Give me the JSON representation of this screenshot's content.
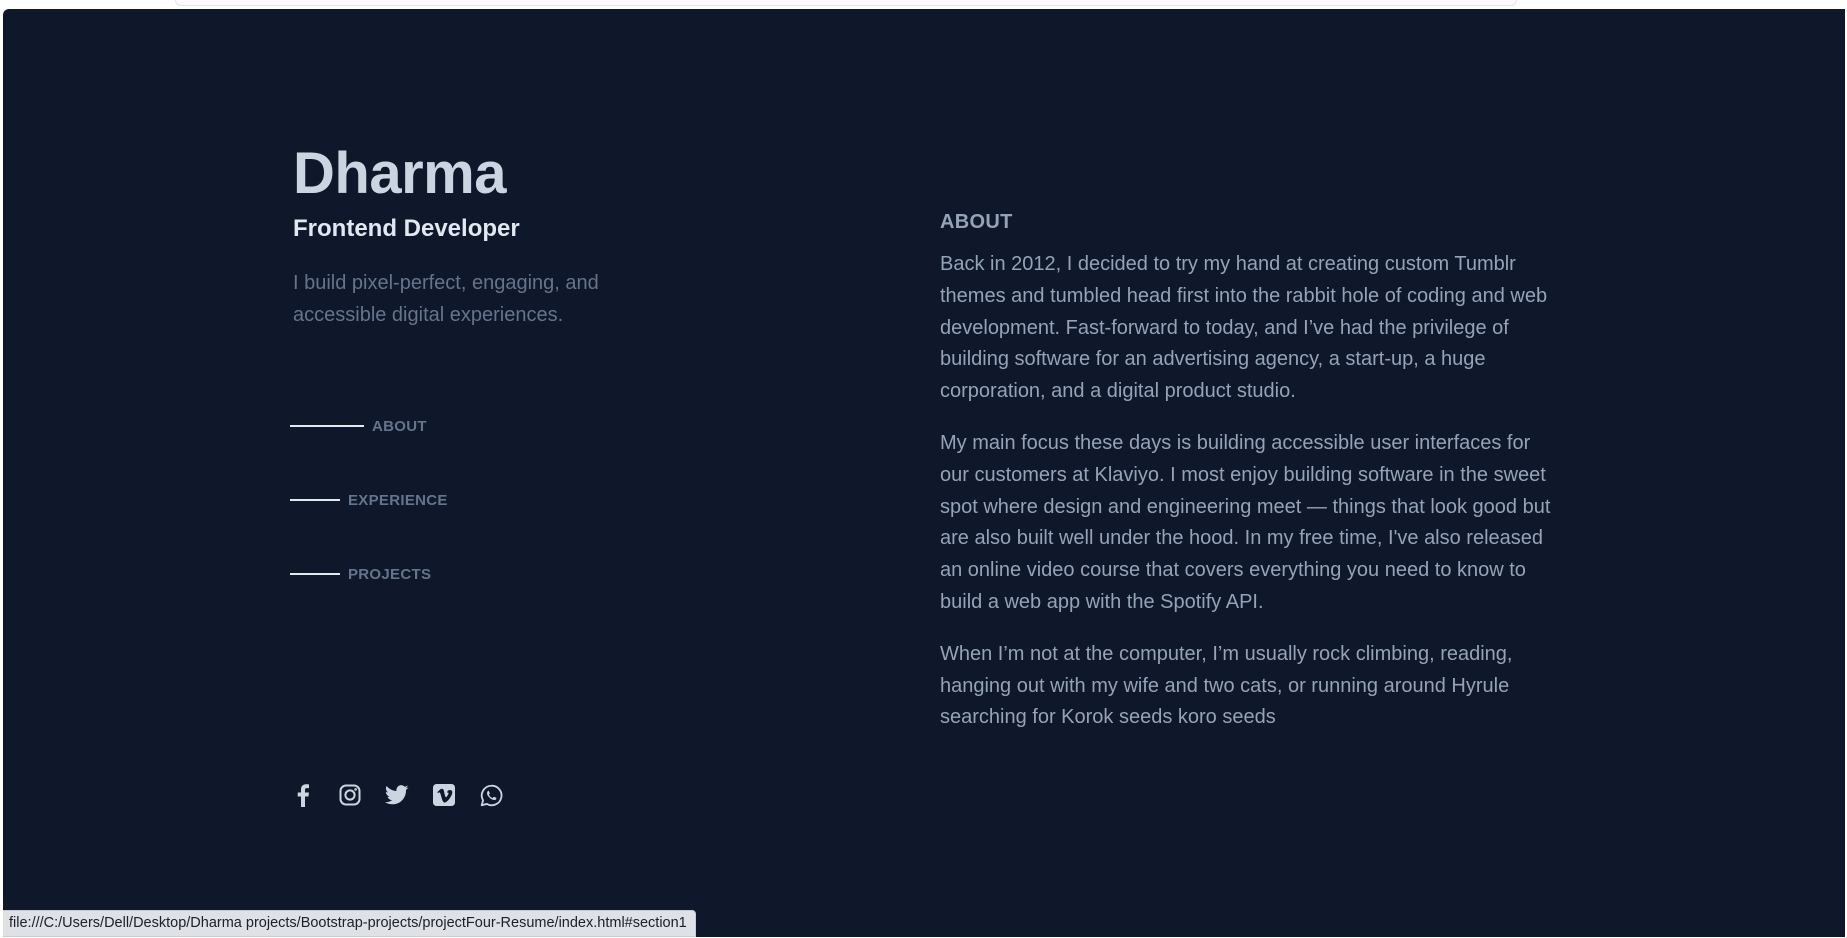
{
  "profile": {
    "name": "Dharma",
    "role": "Frontend Developer",
    "tagline": "I build pixel-perfect, engaging, and accessible digital experiences."
  },
  "nav": {
    "items": [
      {
        "label": "ABOUT",
        "active": true
      },
      {
        "label": "EXPERIENCE",
        "active": false
      },
      {
        "label": "PROJECTS",
        "active": false
      }
    ]
  },
  "socials": [
    "facebook-icon",
    "instagram-icon",
    "twitter-icon",
    "vimeo-icon",
    "whatsapp-icon"
  ],
  "about": {
    "title": "ABOUT",
    "paragraphs": [
      "Back in 2012, I decided to try my hand at creating custom Tumblr themes and tumbled head first into the rabbit hole of coding and web development. Fast-forward to today, and I’ve had the privilege of building software for an advertising agency, a start-up, a huge corporation, and a digital product studio.",
      "My main focus these days is building accessible user interfaces for our customers at Klaviyo. I most enjoy building software in the sweet spot where design and engineering meet — things that look good but are also built well under the hood. In my free time, I've also released an online video course that covers everything you need to know to build a web app with the Spotify API.",
      "When I’m not at the computer, I’m usually rock climbing, reading, hanging out with my wife and two cats, or running around Hyrule searching for Korok seeds koro seeds"
    ]
  },
  "status_bar": {
    "url": "file:///C:/Users/Dell/Desktop/Dharma projects/Bootstrap-projects/projectFour-Resume/index.html#section1"
  },
  "colors": {
    "background": "#0f172a",
    "heading": "#cbd5e1",
    "body_text": "#94a3b8",
    "muted_text": "#64748b",
    "accent_line": "#e2e8f0"
  }
}
